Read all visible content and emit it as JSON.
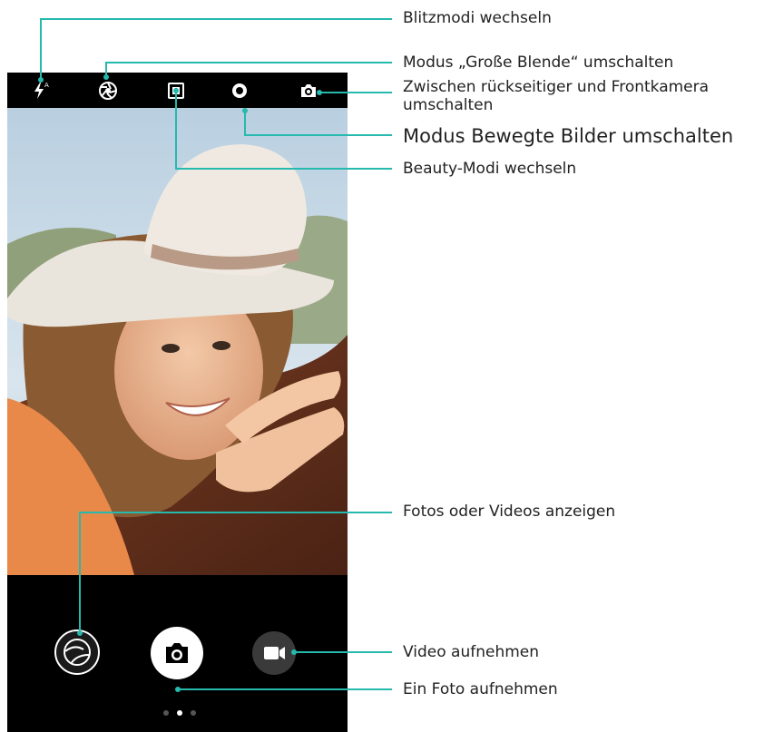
{
  "callouts": {
    "flash": "Blitzmodi wechseln",
    "aperture": "Modus „Große Blende“ umschalten",
    "switch_camera": "Zwischen rückseitiger und Frontkamera umschalten",
    "moving_pictures": "Modus Bewegte Bilder umschalten",
    "beauty": "Beauty-Modi wechseln",
    "gallery": "Fotos oder Videos anzeigen",
    "video": "Video aufnehmen",
    "photo": "Ein Foto aufnehmen"
  },
  "icons": {
    "flash": "flash-auto-icon",
    "aperture": "aperture-icon",
    "beauty": "beauty-mode-icon",
    "moving_pictures": "moving-picture-icon",
    "switch_camera": "switch-camera-icon",
    "gallery": "gallery-thumbnail-icon",
    "shutter": "camera-shutter-icon",
    "video": "video-camera-icon"
  },
  "colors": {
    "callout_line": "#26b9ad",
    "bar": "#000000",
    "icon": "#ffffff"
  },
  "pager": {
    "pages": 3,
    "active": 1
  }
}
